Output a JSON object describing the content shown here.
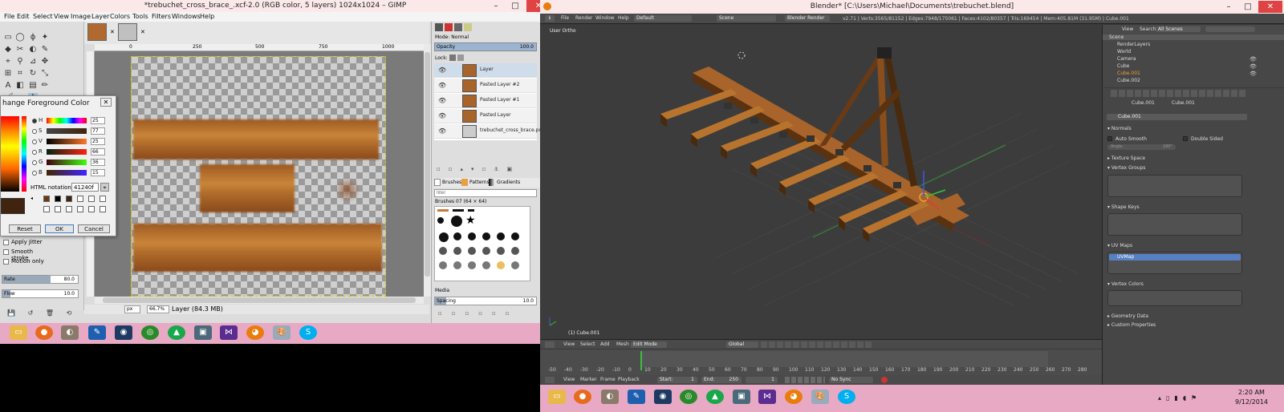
{
  "gimp": {
    "title": "*trebuchet_cross_brace_.xcf-2.0 (RGB color, 5 layers) 1024x1024 – GIMP",
    "menus": [
      "File",
      "Edit",
      "Select",
      "View",
      "Image",
      "Layer",
      "Colors",
      "Tools",
      "Filters",
      "Windows",
      "Help"
    ],
    "ruler_ticks": [
      "0",
      "250",
      "500",
      "750",
      "1000"
    ],
    "status": {
      "unit": "px",
      "zoom": "66.7%",
      "layer_info": "Layer (84.3 MB)"
    },
    "tool_options": {
      "apply_jitter": "Apply Jitter",
      "smooth_stroke": "Smooth stroke",
      "motion_only": "Motion only",
      "rate_label": "Rate",
      "rate_value": "80.0",
      "flow_label": "Flow",
      "flow_value": "10.0"
    },
    "dock": {
      "mode_label": "Mode: Normal",
      "opacity_label": "Opacity",
      "opacity_value": "100.0",
      "lock_label": "Lock:",
      "layers": [
        "Layer",
        "Pasted Layer #2",
        "Pasted Layer #1",
        "Pasted Layer",
        "trebuchet_cross_brace.png"
      ],
      "tabs": [
        "Brushes",
        "Patterns",
        "Gradients"
      ],
      "filter_placeholder": "filter",
      "brush_name": "Brushes 07 (64 × 64)",
      "media_label": "Media",
      "spacing_label": "Spacing",
      "spacing_value": "10.0"
    }
  },
  "fg_dialog": {
    "title": "hange Foreground Color",
    "sliders": [
      {
        "label": "H",
        "value": "25"
      },
      {
        "label": "S",
        "value": "77"
      },
      {
        "label": "V",
        "value": "25"
      },
      {
        "label": "R",
        "value": "66"
      },
      {
        "label": "G",
        "value": "36"
      },
      {
        "label": "B",
        "value": "15"
      }
    ],
    "html_label": "HTML notation:",
    "html_value": "41240f",
    "buttons": {
      "reset": "Reset",
      "ok": "OK",
      "cancel": "Cancel"
    },
    "current_color": "#41240f"
  },
  "blender": {
    "title": "Blender* [C:\\Users\\Michael\\Documents\\trebuchet.blend]",
    "menus": [
      "File",
      "Render",
      "Window",
      "Help"
    ],
    "layout": "Default",
    "scene": "Scene",
    "engine": "Blender Render",
    "stats": "v2.71 | Verts:3565/81152 | Edges:7948/175061 | Faces:4102/80357 | Tris:169454 | Mem:405.81M (31.95M) | Cube.001",
    "viewport_label": "User Ortho",
    "selected_object": "(1) Cube.001",
    "viewport_menus": [
      "View",
      "Select",
      "Add",
      "Mesh"
    ],
    "mode": "Edit Mode",
    "orientation": "Global",
    "timeline": {
      "ticks": [
        "-50",
        "-40",
        "-30",
        "-20",
        "-10",
        "0",
        "10",
        "20",
        "30",
        "40",
        "50",
        "60",
        "70",
        "80",
        "90",
        "100",
        "110",
        "120",
        "130",
        "140",
        "150",
        "160",
        "170",
        "180",
        "190",
        "200",
        "210",
        "220",
        "230",
        "240",
        "250",
        "260",
        "270",
        "280"
      ],
      "menus": [
        "View",
        "Marker",
        "Frame",
        "Playback"
      ],
      "start": "Start:",
      "start_value": "1",
      "end": "End:",
      "end_value": "250",
      "current": "1",
      "sync": "No Sync"
    },
    "outliner": {
      "menus": [
        "View",
        "Search",
        "All Scenes"
      ],
      "items": [
        "Scene",
        "RenderLayers",
        "World",
        "Camera",
        "Cube",
        "Cube.001",
        "Cube.002"
      ]
    },
    "props": {
      "breadcrumb": [
        "Cube.001",
        "Cube.001"
      ],
      "mesh_name": "Cube.001",
      "panels": {
        "normals": "Normals",
        "auto_smooth": "Auto Smooth",
        "double_sided": "Double Sided",
        "angle": "Angle:",
        "angle_value": "180°",
        "texture_space": "Texture Space",
        "vertex_groups": "Vertex Groups",
        "shape_keys": "Shape Keys",
        "uv_maps": "UV Maps",
        "uv_map_name": "UVMap",
        "vertex_colors": "Vertex Colors",
        "geometry_data": "Geometry Data",
        "custom_properties": "Custom Properties"
      }
    }
  },
  "taskbar": {
    "clock_time": "2:20 AM",
    "clock_date": "9/12/2014"
  }
}
